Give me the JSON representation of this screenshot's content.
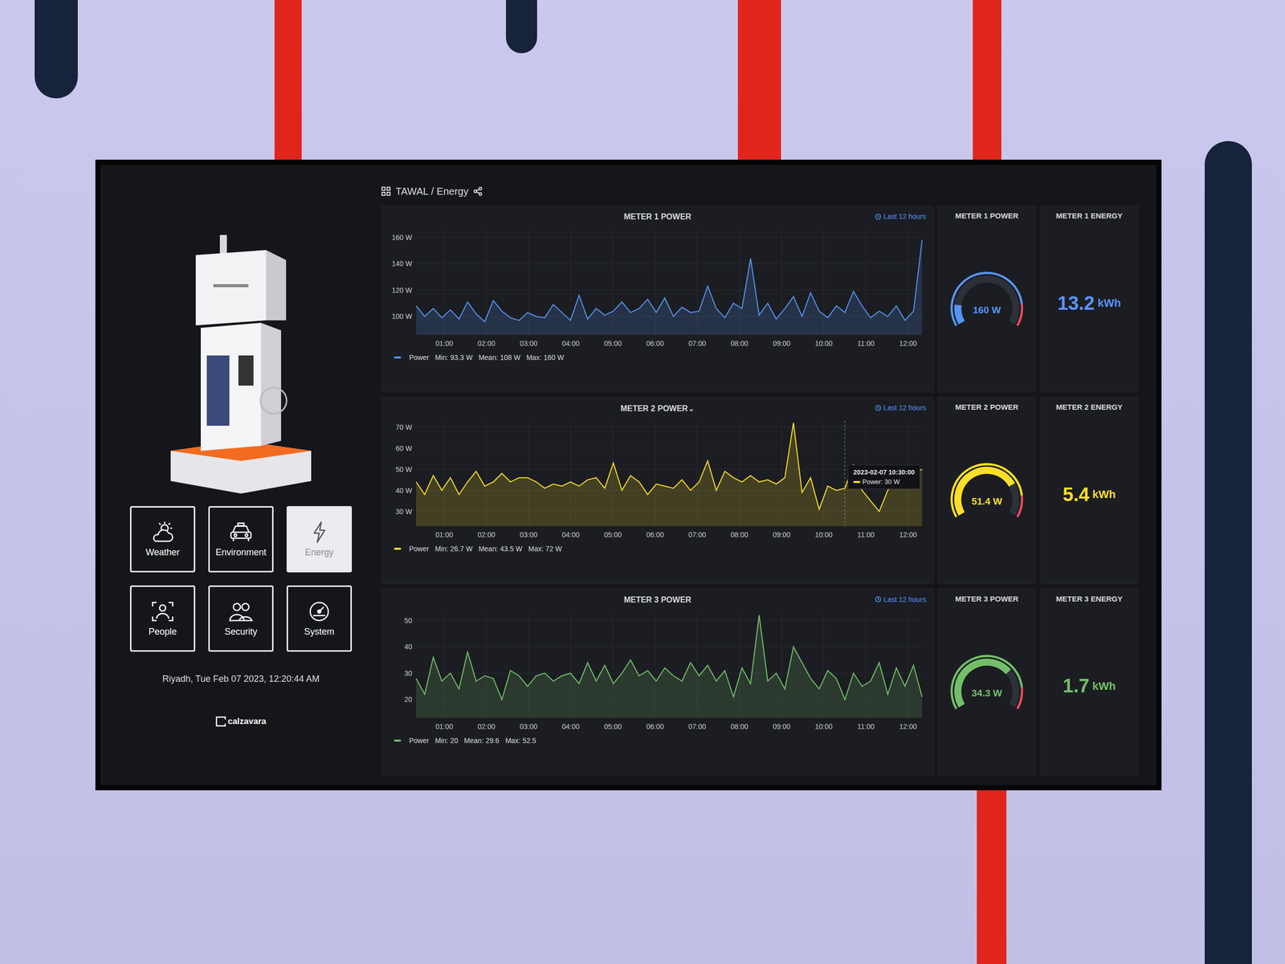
{
  "dashboard": {
    "breadcrumb": "TAWAL / Energy"
  },
  "nav": [
    {
      "label": "Weather",
      "selected": false
    },
    {
      "label": "Environment",
      "selected": false
    },
    {
      "label": "Energy",
      "selected": true
    },
    {
      "label": "People",
      "selected": false
    },
    {
      "label": "Security",
      "selected": false
    },
    {
      "label": "System",
      "selected": false
    }
  ],
  "datetime": "Riyadh, Tue Feb 07 2023, 12:20:44 AM",
  "brand": "calzavara",
  "meters": [
    {
      "color": "#5794f2",
      "chart": {
        "title": "METER 1 POWER",
        "menu_glyph": "",
        "range": "Last 12 hours",
        "y_ticks": [
          "100 W",
          "120 W",
          "140 W",
          "160 W"
        ],
        "x_ticks": [
          "01:00",
          "02:00",
          "03:00",
          "04:00",
          "05:00",
          "06:00",
          "07:00",
          "08:00",
          "09:00",
          "10:00",
          "11:00",
          "12:00"
        ],
        "legend": {
          "label": "Power",
          "min": "Min: 93.3 W",
          "mean": "Mean: 108 W",
          "max": "Max: 160 W"
        },
        "values": [
          108,
          100,
          106,
          99,
          105,
          98,
          111,
          102,
          96,
          112,
          104,
          99,
          97,
          103,
          100,
          99,
          109,
          103,
          97,
          116,
          98,
          106,
          101,
          104,
          111,
          103,
          106,
          113,
          103,
          114,
          100,
          107,
          103,
          104,
          123,
          106,
          99,
          110,
          106,
          144,
          101,
          110,
          98,
          106,
          115,
          100,
          118,
          104,
          99,
          108,
          103,
          119,
          108,
          99,
          104,
          100,
          108,
          97,
          104,
          158
        ]
      },
      "gauge": {
        "title": "METER 1 POWER",
        "reading": "160 W",
        "level": 0.15
      },
      "energy": {
        "title": "METER 1 ENERGY",
        "value": "13.2",
        "unit": "kWh"
      }
    },
    {
      "color": "#fade2a",
      "chart": {
        "title": "METER 2 POWER",
        "menu_glyph": "⌄",
        "range": "Last 12 hours",
        "y_ticks": [
          "30 W",
          "40 W",
          "50 W",
          "60 W",
          "70 W"
        ],
        "x_ticks": [
          "01:00",
          "02:00",
          "03:00",
          "04:00",
          "05:00",
          "06:00",
          "07:00",
          "08:00",
          "09:00",
          "10:00",
          "11:00",
          "12:00"
        ],
        "legend": {
          "label": "Power",
          "min": "Min: 26.7 W",
          "mean": "Mean: 43.5 W",
          "max": "Max: 72 W"
        },
        "values": [
          44,
          38,
          47,
          40,
          46,
          38,
          44,
          49,
          42,
          44,
          48,
          44,
          46,
          46,
          44,
          41,
          43,
          42,
          44,
          42,
          45,
          46,
          41,
          53,
          40,
          47,
          44,
          38,
          43,
          42,
          41,
          45,
          40,
          44,
          54,
          40,
          49,
          46,
          44,
          47,
          44,
          45,
          43,
          46,
          72,
          39,
          46,
          31,
          42,
          40,
          41,
          52,
          40,
          35,
          30,
          40,
          47,
          50,
          48,
          50
        ]
      },
      "gauge": {
        "title": "METER 2 POWER",
        "reading": "51.4 W",
        "level": 0.75
      },
      "energy": {
        "title": "METER 2 ENERGY",
        "value": "5.4",
        "unit": "kWh"
      },
      "tooltip": {
        "time": "2023-02-07 10:30:00",
        "text": "Power: 30 W"
      }
    },
    {
      "color": "#73bf69",
      "chart": {
        "title": "METER 3 POWER",
        "menu_glyph": "",
        "range": "Last 12 hours",
        "y_ticks": [
          "20",
          "30",
          "40",
          "50"
        ],
        "x_ticks": [
          "01:00",
          "02:00",
          "03:00",
          "04:00",
          "05:00",
          "06:00",
          "07:00",
          "08:00",
          "09:00",
          "10:00",
          "11:00",
          "12:00"
        ],
        "legend": {
          "label": "Power",
          "min": "Min: 20",
          "mean": "Mean: 29.6",
          "max": "Max: 52.5"
        },
        "values": [
          28,
          22,
          36,
          27,
          30,
          24,
          38,
          27,
          29,
          28,
          20,
          31,
          29,
          25,
          29,
          30,
          27,
          29,
          30,
          26,
          34,
          27,
          33,
          26,
          30,
          35,
          29,
          31,
          27,
          32,
          29,
          27,
          34,
          29,
          33,
          27,
          31,
          21,
          32,
          26,
          52,
          27,
          30,
          24,
          40,
          34,
          28,
          24,
          31,
          28,
          20,
          30,
          25,
          27,
          34,
          22,
          32,
          25,
          33,
          21
        ]
      },
      "gauge": {
        "title": "METER 3 POWER",
        "reading": "34.3 W",
        "level": 0.7
      },
      "energy": {
        "title": "METER 3 ENERGY",
        "value": "1.7",
        "unit": "kWh"
      }
    }
  ]
}
